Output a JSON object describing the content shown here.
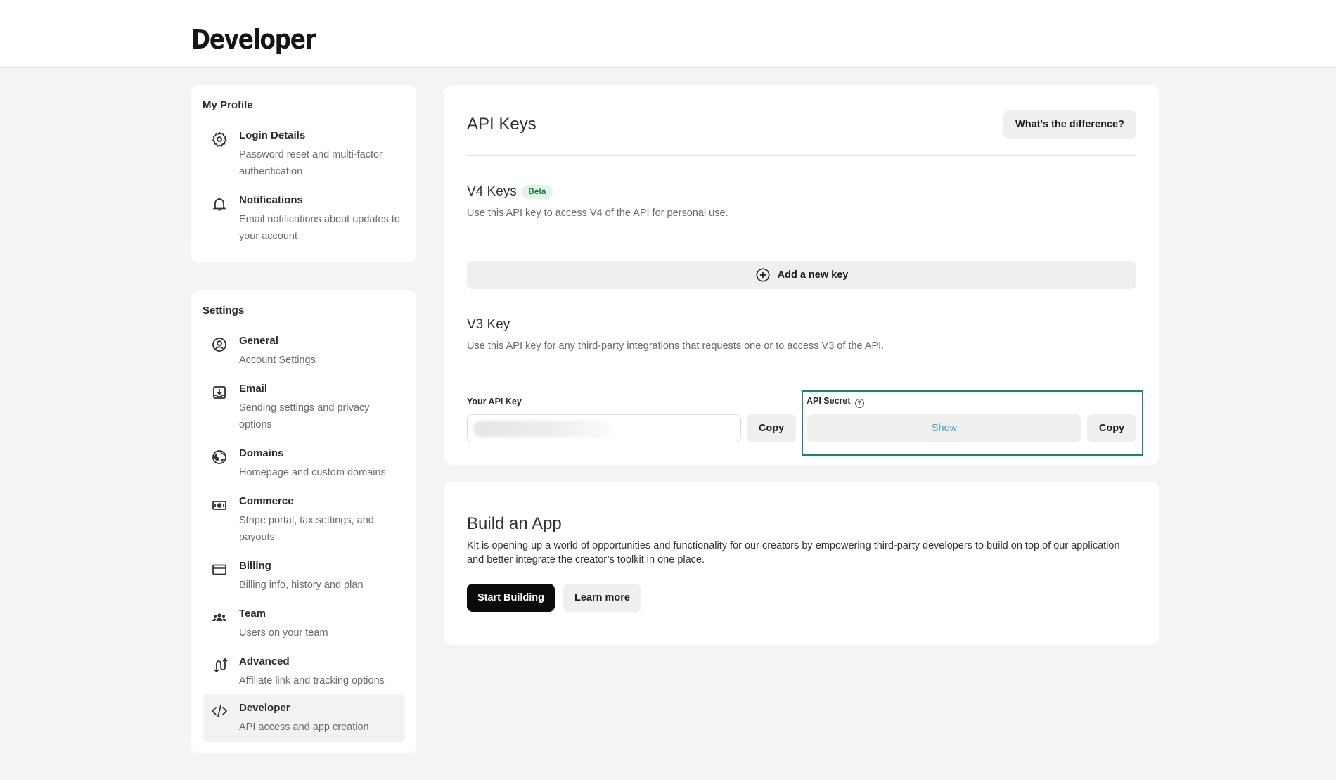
{
  "header": {
    "brand": "Developer"
  },
  "sidebar": {
    "profile": {
      "heading": "My Profile",
      "items": [
        {
          "title": "Login Details",
          "description": "Password reset and multi-factor authentication",
          "icon": "gear-icon"
        },
        {
          "title": "Notifications",
          "description": "Email notifications about updates to your account",
          "icon": "bell-icon"
        }
      ]
    },
    "settings": {
      "heading": "Settings",
      "items": [
        {
          "title": "General",
          "description": "Account Settings",
          "icon": "user-circle-icon"
        },
        {
          "title": "Email",
          "description": "Sending settings and privacy options",
          "icon": "inbox-download-icon"
        },
        {
          "title": "Domains",
          "description": "Homepage and custom domains",
          "icon": "globe-icon"
        },
        {
          "title": "Commerce",
          "description": "Stripe portal, tax settings, and payouts",
          "icon": "money-icon"
        },
        {
          "title": "Billing",
          "description": "Billing info, history and plan",
          "icon": "credit-card-icon"
        },
        {
          "title": "Team",
          "description": "Users on your team",
          "icon": "team-icon"
        },
        {
          "title": "Advanced",
          "description": "Affiliate link and tracking options",
          "icon": "advanced-icon"
        },
        {
          "title": "Developer",
          "description": "API access and app creation",
          "icon": "code-icon",
          "active": true
        }
      ]
    }
  },
  "api_keys": {
    "title": "API Keys",
    "difference_button": "What's the difference?",
    "v4": {
      "title": "V4 Keys",
      "badge": "Beta",
      "description": "Use this API key to access V4 of the API for personal use.",
      "add_button": "Add a new key"
    },
    "v3": {
      "title": "V3 Key",
      "description": "Use this API key for any third-party integrations that requests one or to access V3 of the API.",
      "api_key_label": "Your API Key",
      "api_key_copy": "Copy",
      "secret_label": "API Secret",
      "secret_show": "Show",
      "secret_copy": "Copy"
    }
  },
  "build_app": {
    "title": "Build an App",
    "description": "Kit is opening up a world of opportunities and functionality for our creators by empowering third-party developers to build on top of our application and better integrate the creator’s toolkit in one place.",
    "start_button": "Start Building",
    "learn_button": "Learn more"
  },
  "colors": {
    "accent_outline": "#14896c",
    "show_link": "#4a9fd8",
    "badge_bg": "#dff5e6"
  }
}
